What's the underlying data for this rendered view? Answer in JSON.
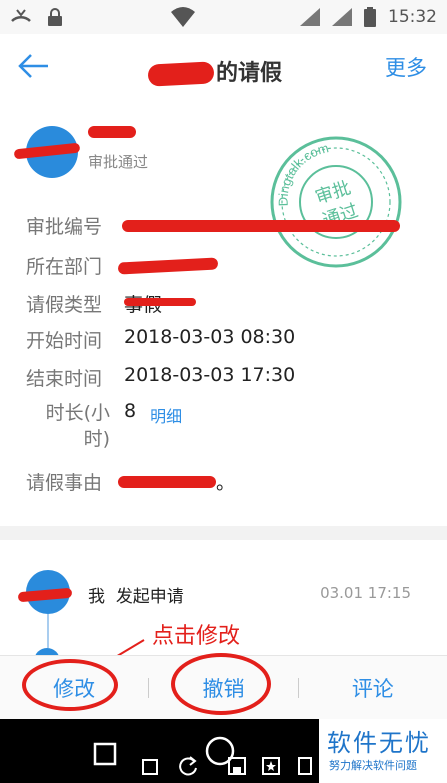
{
  "status_bar": {
    "time": "15:32"
  },
  "nav": {
    "title_suffix": "的请假",
    "more": "更多"
  },
  "applicant": {
    "status": "审批通过"
  },
  "stamp": {
    "domain": "Dingtalk.com",
    "line1": "审批",
    "line2": "通过"
  },
  "fields": [
    {
      "label": "审批编号",
      "value": ""
    },
    {
      "label": "所在部门",
      "value": ""
    },
    {
      "label": "请假类型",
      "value": "事假"
    },
    {
      "label": "开始时间",
      "value": "2018-03-03 08:30"
    },
    {
      "label": "结束时间",
      "value": "2018-03-03 17:30"
    }
  ],
  "duration": {
    "label_line1": "时长(小",
    "label_line2": "时)",
    "value": "8",
    "detail_link": "明细"
  },
  "reason": {
    "label": "请假事由",
    "tail": "。"
  },
  "flow": {
    "actor": "我",
    "action": "发起申请",
    "time": "03.01 17:15"
  },
  "annotation": "点击修改",
  "toolbar": {
    "modify": "修改",
    "revoke": "撤销",
    "comment": "评论"
  },
  "watermark": {
    "main": "软件无忧",
    "sub": "努力解决软件问题"
  },
  "colors": {
    "accent": "#2e8ee5",
    "redact": "#e3201b",
    "stamp": "#5bbf9a"
  }
}
